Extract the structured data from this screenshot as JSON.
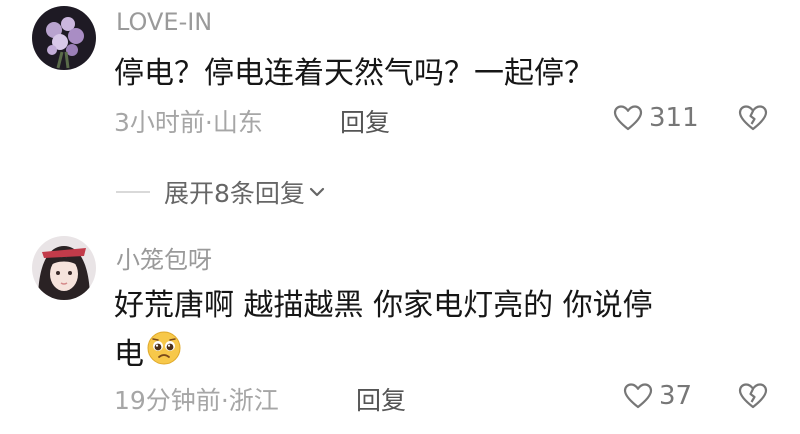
{
  "comments": [
    {
      "username": "LOVE-IN",
      "content_lines": [
        "停电？停电连着天然气吗？一起停？"
      ],
      "time": "3小时前",
      "separator": "·",
      "location": "山东",
      "reply_label": "回复",
      "likes": "311",
      "avatar_icon": "flower-bouquet-avatar",
      "dislike_icon": "broken-heart-icon"
    },
    {
      "username": "小笼包呀",
      "content_lines": [
        "好荒唐啊 越描越黑 你家电灯亮的 你说停",
        "电"
      ],
      "emoji_icon": "pleading-face-emoji",
      "time": "19分钟前",
      "separator": "·",
      "location": "浙江",
      "reply_label": "回复",
      "likes": "37",
      "avatar_icon": "girl-portrait-avatar",
      "dislike_icon": "broken-heart-icon"
    }
  ],
  "expand_replies": {
    "label": "展开8条回复",
    "icon": "chevron-down-icon"
  },
  "colors": {
    "username": "#9a9a9a",
    "content": "#161616",
    "meta": "#a6a6a6",
    "reply": "#555555"
  }
}
